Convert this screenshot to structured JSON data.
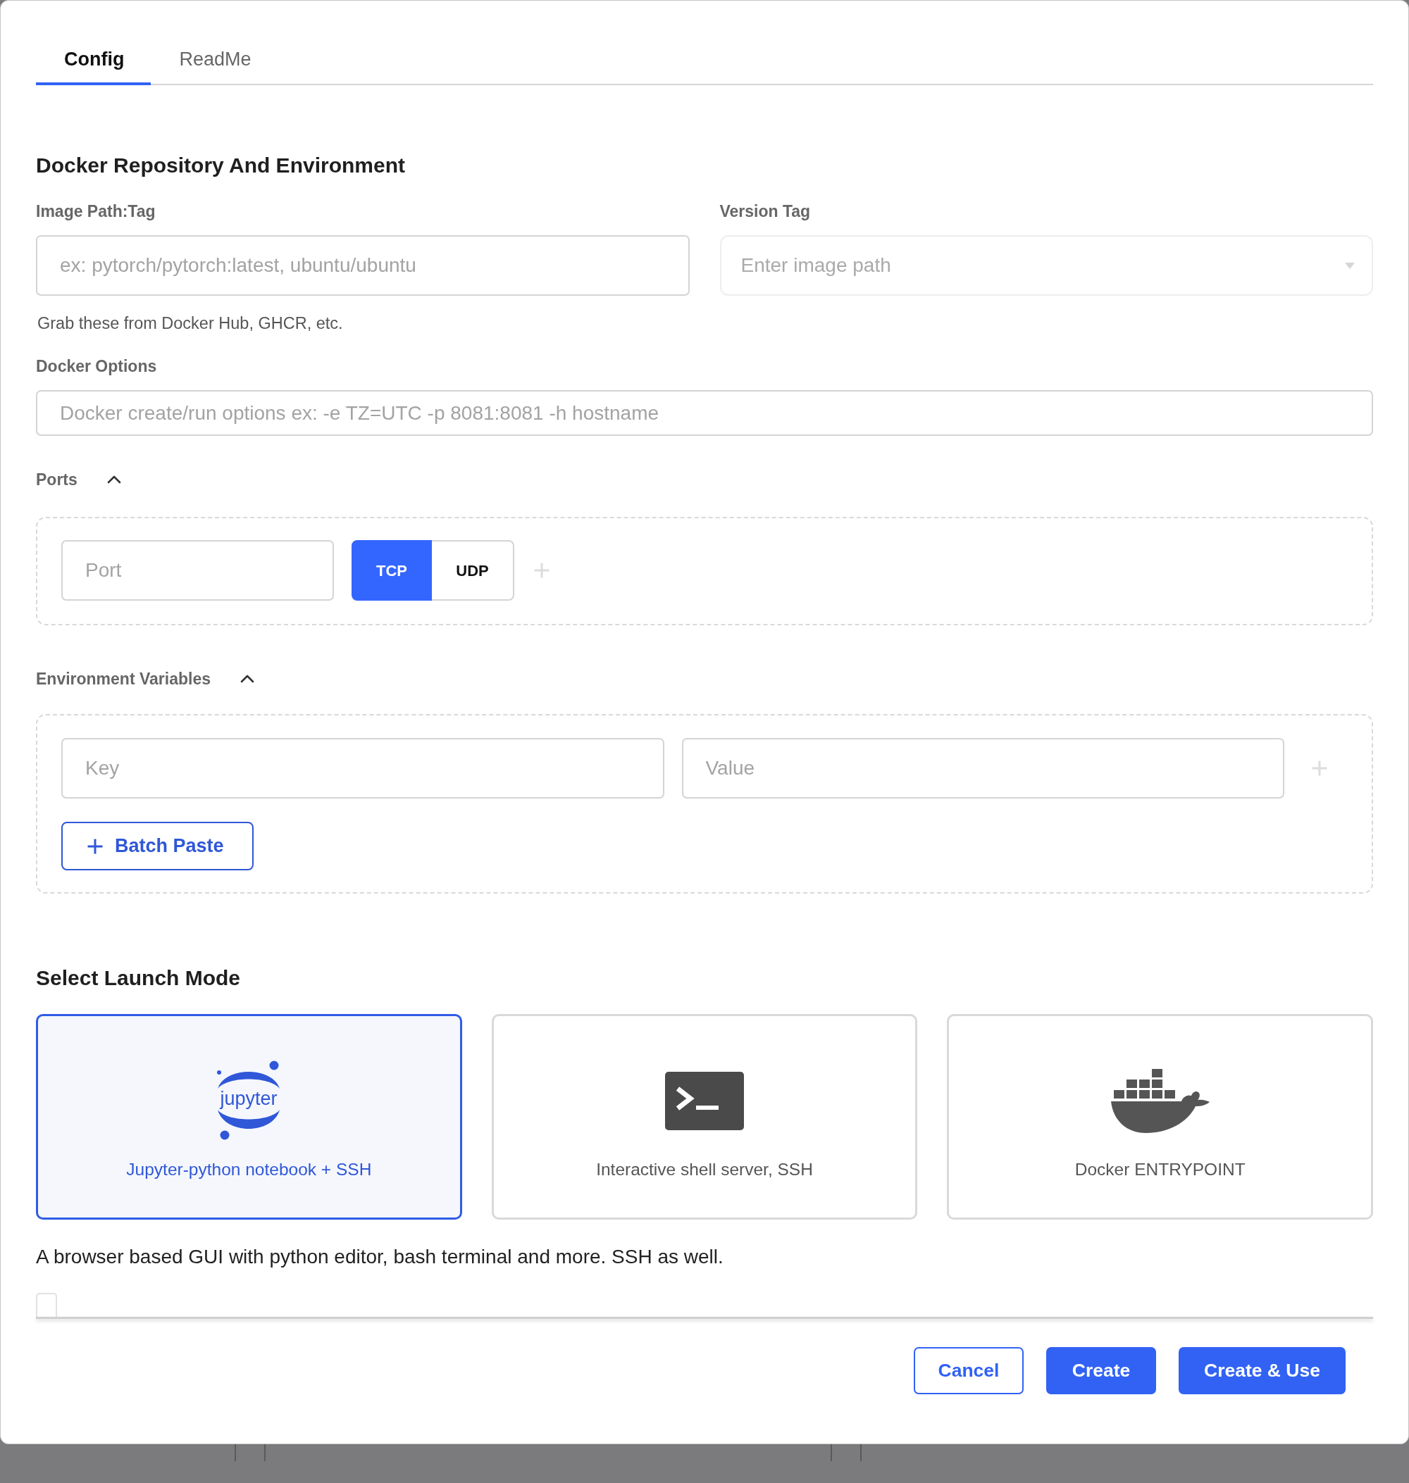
{
  "tabs": [
    {
      "label": "Config",
      "selected": true
    },
    {
      "label": "ReadMe",
      "selected": false
    }
  ],
  "docker_section": {
    "title": "Docker Repository And Environment",
    "image_path": {
      "label": "Image Path:Tag",
      "placeholder": "ex: pytorch/pytorch:latest, ubuntu/ubuntu",
      "help": "Grab these from Docker Hub, GHCR, etc."
    },
    "version_tag": {
      "label": "Version Tag",
      "placeholder": "Enter image path",
      "disabled": true
    },
    "docker_options": {
      "label": "Docker Options",
      "placeholder": "Docker create/run options ex: -e TZ=UTC -p 8081:8081 -h hostname"
    },
    "ports": {
      "label": "Ports",
      "expanded": true,
      "rows": [
        {
          "port": {
            "placeholder": "Port"
          },
          "protocols": [
            {
              "label": "TCP",
              "selected": true
            },
            {
              "label": "UDP",
              "selected": false
            }
          ]
        }
      ]
    },
    "environment_variables": {
      "label": "Environment Variables",
      "expanded": true,
      "rows": [
        {
          "key": {
            "placeholder": "Key"
          },
          "value": {
            "placeholder": "Value"
          }
        }
      ],
      "batch_paste_button": "Batch Paste"
    }
  },
  "launch_mode": {
    "title": "Select Launch Mode",
    "modes": [
      {
        "kind": "jupyter",
        "logo_text": "jupyter",
        "label": "Jupyter-python notebook + SSH",
        "selected": true
      },
      {
        "kind": "shell",
        "label": "Interactive shell server, SSH",
        "selected": false
      },
      {
        "kind": "docker",
        "label": "Docker ENTRYPOINT",
        "selected": false
      }
    ],
    "description": "A browser based GUI with python editor, bash terminal and more. SSH as well.",
    "checkbox": {
      "checked": false
    }
  },
  "footer": {
    "buttons": [
      {
        "label": "Cancel",
        "kind": "outline"
      },
      {
        "label": "Create",
        "kind": "primary"
      },
      {
        "label": "Create & Use",
        "kind": "primary"
      }
    ]
  }
}
